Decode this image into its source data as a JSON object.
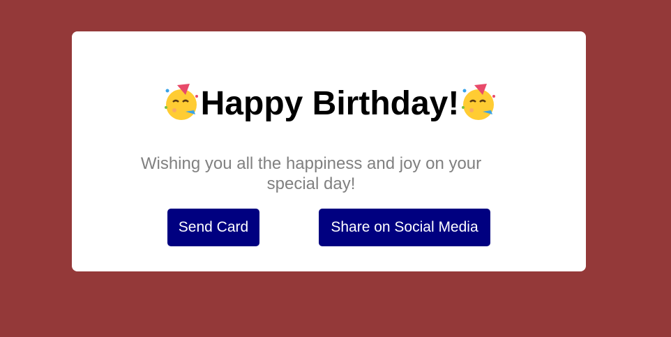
{
  "page": {
    "background_color": "#943939"
  },
  "card": {
    "title": "Happy Birthday!",
    "title_emoji_icon": "partying-face-icon",
    "message": "Wishing you all the happiness and joy on your special day!",
    "send_button_label": "Send Card",
    "share_button_label": "Share on Social Media",
    "button_color": "#000080"
  }
}
